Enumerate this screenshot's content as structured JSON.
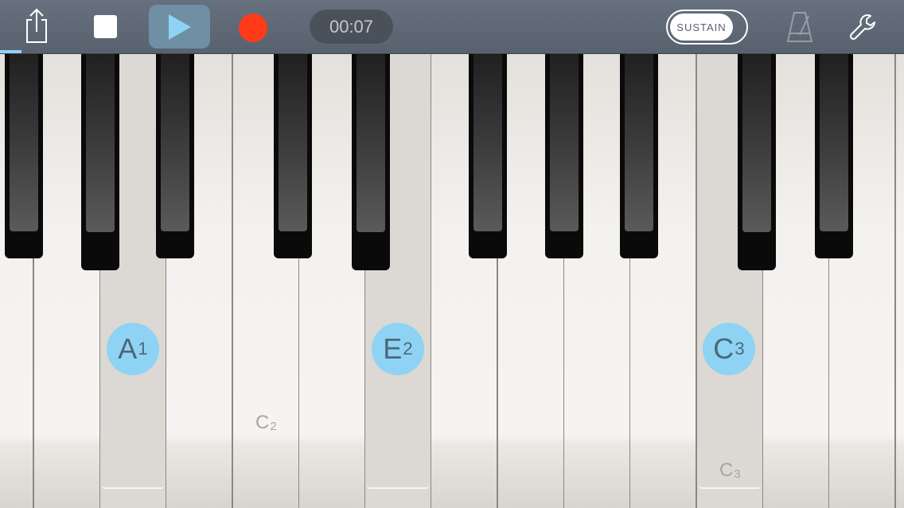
{
  "toolbar": {
    "timer": "00:07",
    "sustain_label": "SUSTAIN",
    "icons": {
      "share": "share-icon",
      "stop": "stop-icon",
      "play": "play-icon",
      "record": "record-icon",
      "metronome": "metronome-icon",
      "settings": "wrench-icon"
    },
    "colors": {
      "toolbar": "#5f6976",
      "record": "#ff3b1a",
      "accent": "#8fd3f4",
      "play_active": "#6f8fa5"
    }
  },
  "keyboard": {
    "highlighted_notes": [
      {
        "note": "A",
        "octave": "1"
      },
      {
        "note": "E",
        "octave": "2"
      },
      {
        "note": "C",
        "octave": "3"
      }
    ],
    "octave_labels": [
      {
        "note": "C",
        "octave": "2"
      },
      {
        "note": "C",
        "octave": "3"
      }
    ]
  }
}
